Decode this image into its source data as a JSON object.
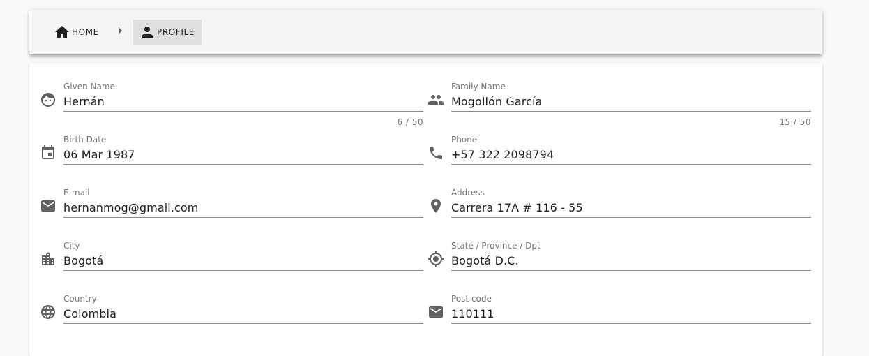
{
  "breadcrumb": {
    "home_label": "HOME",
    "profile_label": "PROFILE"
  },
  "form": {
    "given_name": {
      "label": "Given Name",
      "value": "Hernán",
      "counter": "6 / 50"
    },
    "family_name": {
      "label": "Family Name",
      "value": "Mogollón García",
      "counter": "15 / 50"
    },
    "birth_date": {
      "label": "Birth Date",
      "value": "06 Mar 1987"
    },
    "phone": {
      "label": "Phone",
      "value": "+57 322 2098794"
    },
    "email": {
      "label": "E-mail",
      "value": "hernanmog@gmail.com"
    },
    "address": {
      "label": "Address",
      "value": "Carrera 17A # 116 - 55"
    },
    "city": {
      "label": "City",
      "value": "Bogotá"
    },
    "state": {
      "label": "State / Province / Dpt",
      "value": "Bogotá D.C."
    },
    "country": {
      "label": "Country",
      "value": "Colombia"
    },
    "post_code": {
      "label": "Post code",
      "value": "110111"
    }
  },
  "icons": {
    "home": "home-icon",
    "profile": "person-icon",
    "given_name": "face-icon",
    "family_name": "people-icon",
    "birth_date": "calendar-icon",
    "phone": "phone-icon",
    "email": "mail-icon",
    "address": "location-pin-icon",
    "city": "city-icon",
    "state": "my-location-icon",
    "country": "globe-icon",
    "post_code": "mail-icon"
  },
  "colors": {
    "toolbar_bg": "#f5f5f5",
    "active_crumb_bg": "#e0e0e0",
    "card_bg": "#ffffff",
    "label_color": "#757575",
    "icon_color": "#616161"
  }
}
